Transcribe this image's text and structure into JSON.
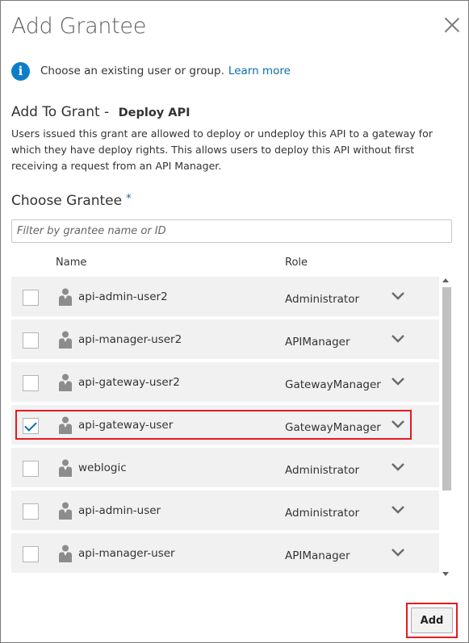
{
  "dialog": {
    "title": "Add Grantee",
    "close_icon": "close-icon"
  },
  "info": {
    "icon": "info-icon",
    "icon_glyph": "i",
    "text": "Choose an existing user or group.",
    "link": "Learn more"
  },
  "grant": {
    "prefix": "Add To Grant - ",
    "name": "Deploy API",
    "description": "Users issued this grant are allowed to deploy or undeploy this API to a gateway for which they have deploy rights. This allows users to deploy this API without first receiving a request from an API Manager."
  },
  "choose": {
    "label": "Choose Grantee",
    "required_mark": "*",
    "filter_placeholder": "Filter by grantee name or ID"
  },
  "columns": {
    "name": "Name",
    "role": "Role"
  },
  "grantees": [
    {
      "name": "api-admin-user2",
      "role": "Administrator",
      "checked": false
    },
    {
      "name": "api-manager-user2",
      "role": "APIManager",
      "checked": false
    },
    {
      "name": "api-gateway-user2",
      "role": "GatewayManager",
      "checked": false
    },
    {
      "name": "api-gateway-user",
      "role": "GatewayManager",
      "checked": true
    },
    {
      "name": "weblogic",
      "role": "Administrator",
      "checked": false
    },
    {
      "name": "api-admin-user",
      "role": "Administrator",
      "checked": false
    },
    {
      "name": "api-manager-user",
      "role": "APIManager",
      "checked": false
    }
  ],
  "footer": {
    "add_label": "Add"
  },
  "colors": {
    "accent": "#0d6ea8",
    "highlight": "#e31b23",
    "row_bg": "#f1f1f1"
  }
}
